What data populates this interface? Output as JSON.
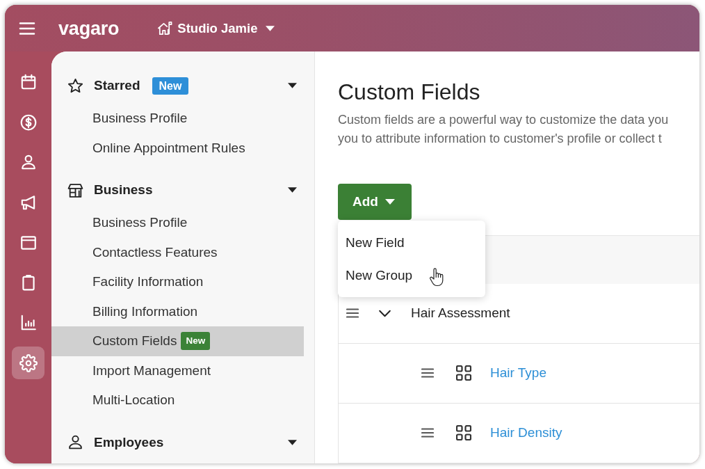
{
  "top_bar": {
    "logo": "vagaro",
    "location": "Studio Jamie"
  },
  "rail": {
    "items": [
      {
        "kind": "calendar",
        "selected": false
      },
      {
        "kind": "money",
        "selected": false
      },
      {
        "kind": "person",
        "selected": false
      },
      {
        "kind": "megaphone",
        "selected": false
      },
      {
        "kind": "window",
        "selected": false
      },
      {
        "kind": "clipboard",
        "selected": false
      },
      {
        "kind": "chart",
        "selected": false
      },
      {
        "kind": "settings",
        "selected": true
      }
    ]
  },
  "sidebar": {
    "sections": [
      {
        "kind": "star",
        "title": "Starred",
        "badge": {
          "text": "New",
          "color": "#2e8fd8"
        },
        "items": [
          {
            "label": "Business Profile",
            "selected": false
          },
          {
            "label": "Online Appointment Rules",
            "selected": false
          }
        ]
      },
      {
        "kind": "store",
        "title": "Business",
        "items": [
          {
            "label": "Business Profile",
            "selected": false
          },
          {
            "label": "Contactless Features",
            "selected": false
          },
          {
            "label": "Facility Information",
            "selected": false
          },
          {
            "label": "Billing Information",
            "selected": false
          },
          {
            "label": "Custom Fields",
            "selected": true,
            "badge": {
              "text": "New",
              "color": "#3b8237"
            }
          },
          {
            "label": "Import Management",
            "selected": false
          },
          {
            "label": "Multi-Location",
            "selected": false
          }
        ]
      },
      {
        "kind": "person",
        "title": "Employees"
      }
    ]
  },
  "main": {
    "title": "Custom Fields",
    "description_lines": [
      "Custom fields are a powerful way to customize the data you",
      "you to attribute information to customer's profile or collect t"
    ],
    "add_button": {
      "label": "Add"
    },
    "add_menu": {
      "items": [
        {
          "label": "New Field"
        },
        {
          "label": "New Group"
        }
      ]
    },
    "table": {
      "rows": [
        {
          "label": "Hair Assessment",
          "expanded": true,
          "children": [
            {
              "label": "Hair Type"
            },
            {
              "label": "Hair Density"
            }
          ]
        }
      ]
    }
  }
}
